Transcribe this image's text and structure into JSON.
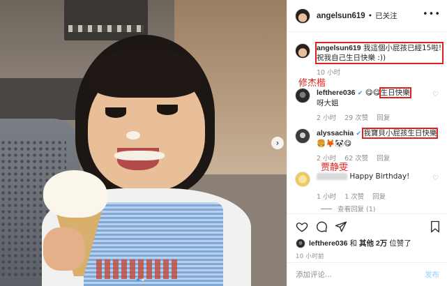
{
  "post": {
    "username": "angelsun619",
    "separator": "•",
    "follow_status": "已关注",
    "more_label": "•••"
  },
  "caption": {
    "username": "angelsun619",
    "text": "我這個小屁孩已經15啦! 祝我自己生日快樂 :))",
    "time": "10 小时"
  },
  "annotations": {
    "first": "修杰楷",
    "second": "贾静雯"
  },
  "comments": [
    {
      "username": "lefthere036",
      "verified_icon": "verified-badge-icon",
      "emoji": "😋😋",
      "highlighted_text": "生日快樂",
      "text_after": "呀大姐",
      "time": "2 小时",
      "likes": "29 次赞",
      "reply": "回复"
    },
    {
      "username": "alyssachia",
      "verified_icon": "verified-badge-icon",
      "highlighted_text": "我寶貝小屁孩生日快樂",
      "emoji_after": "🍔🦊🐼😋",
      "time": "2 小时",
      "likes": "62 次赞",
      "reply": "回复"
    },
    {
      "text": "Happy Birthday!",
      "time": "1 小时",
      "likes": "1 次赞",
      "reply": "回复"
    }
  ],
  "view_replies": "查看回复 (1)",
  "actions": {
    "like_icon": "heart-icon",
    "comment_icon": "comment-icon",
    "share_icon": "share-icon",
    "save_icon": "bookmark-icon"
  },
  "likes_summary": {
    "user": "lefthere036",
    "conjunction": "和",
    "others_prefix": "其他",
    "count": "2万",
    "suffix": "位赞了"
  },
  "post_time": "10 小时前",
  "composer": {
    "placeholder": "添加评论...",
    "post_button": "发布"
  },
  "colors": {
    "accent_blue": "#3897f0",
    "annotation_red": "#e02020",
    "muted_text": "#8e8e8e",
    "border": "#efefef"
  }
}
